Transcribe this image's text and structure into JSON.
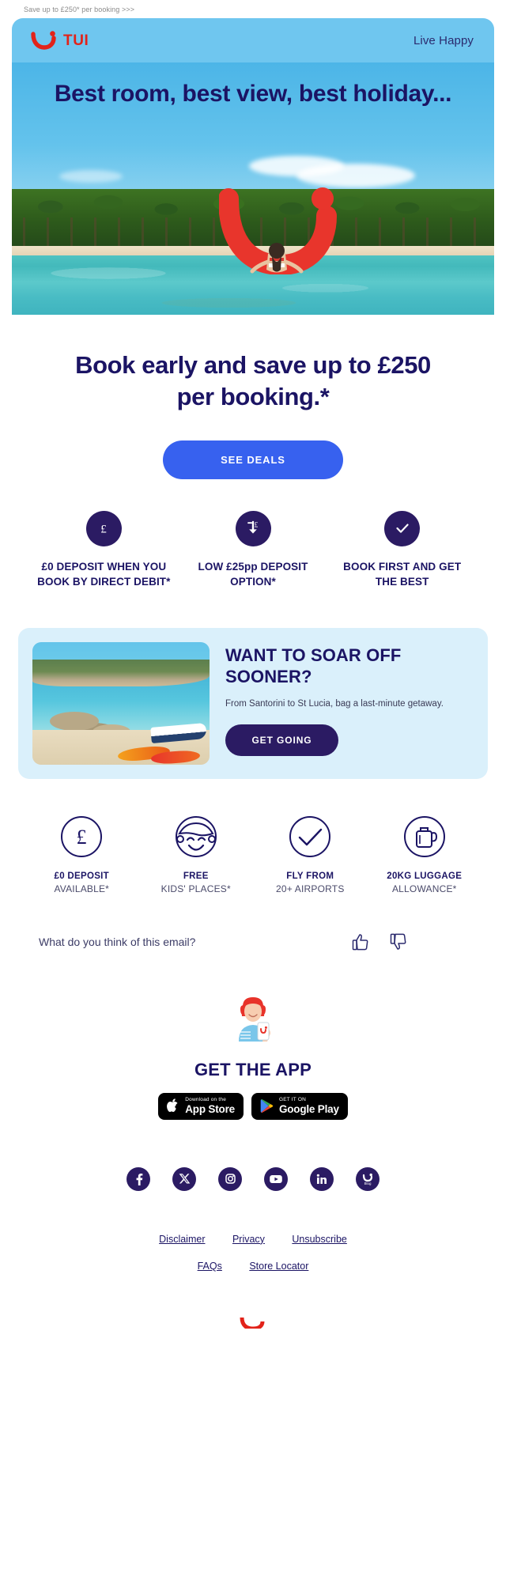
{
  "preheader": "Save up to £250* per booking >>>",
  "header": {
    "brand": "TUI",
    "tagline": "Live Happy",
    "logo_icon": "tui-smile-logo",
    "bg_color": "#6fc6ef"
  },
  "hero": {
    "headline": "Best room, best view, best holiday...",
    "image_alt": "beach-palm-trees-swimmer"
  },
  "main": {
    "heading": "Book early and save up to £250 per booking.*",
    "cta_label": "SEE DEALS",
    "cta_color": "#3761ef"
  },
  "usps": [
    {
      "icon": "pound-circle-icon",
      "text": "£0 DEPOSIT WHEN YOU BOOK BY DIRECT DEBIT*"
    },
    {
      "icon": "low-deposit-arrow-icon",
      "text": "LOW £25pp DEPOSIT OPTION*"
    },
    {
      "icon": "check-circle-icon",
      "text": "BOOK FIRST AND GET THE BEST"
    }
  ],
  "promo": {
    "title": "WANT TO SOAR OFF SOONER?",
    "subtitle": "From Santorini to St Lucia, bag a last-minute getaway.",
    "cta_label": "GET GOING",
    "bg_color": "#daf0fb",
    "image_alt": "cove-with-kayaks"
  },
  "benefits": [
    {
      "icon": "pound-outline-icon",
      "line1": "£0 DEPOSIT",
      "line2": "AVAILABLE*"
    },
    {
      "icon": "kids-face-outline-icon",
      "line1": "FREE",
      "line2": "KIDS' PLACES*"
    },
    {
      "icon": "check-outline-icon",
      "line1": "FLY FROM",
      "line2": "20+ AIRPORTS"
    },
    {
      "icon": "luggage-outline-icon",
      "line1": "20KG LUGGAGE",
      "line2": "ALLOWANCE*"
    }
  ],
  "feedback": {
    "question": "What do you think of this email?",
    "thumbs_up_icon": "thumbs-up-icon",
    "thumbs_down_icon": "thumbs-down-icon"
  },
  "app": {
    "illustration": "woman-with-phone-illustration",
    "title": "GET THE APP",
    "badges": [
      {
        "icon": "apple-icon",
        "small": "Download on the",
        "big": "App Store"
      },
      {
        "icon": "google-play-icon",
        "small": "GET IT ON",
        "big": "Google Play"
      }
    ]
  },
  "social": [
    {
      "icon": "facebook-icon",
      "name": "Facebook"
    },
    {
      "icon": "x-twitter-icon",
      "name": "X"
    },
    {
      "icon": "instagram-icon",
      "name": "Instagram"
    },
    {
      "icon": "youtube-icon",
      "name": "YouTube"
    },
    {
      "icon": "linkedin-icon",
      "name": "LinkedIn"
    },
    {
      "icon": "blog-icon",
      "name": "Blog"
    }
  ],
  "footer_links": [
    [
      "Disclaimer",
      "Privacy",
      "Unsubscribe"
    ],
    [
      "FAQs",
      "Store Locator"
    ]
  ],
  "colors": {
    "navy": "#1b1464",
    "deep_navy": "#2b1b63",
    "tui_red": "#e2231a",
    "sky": "#6fc6ef",
    "pale_blue": "#daf0fb",
    "blue_cta": "#3761ef"
  }
}
